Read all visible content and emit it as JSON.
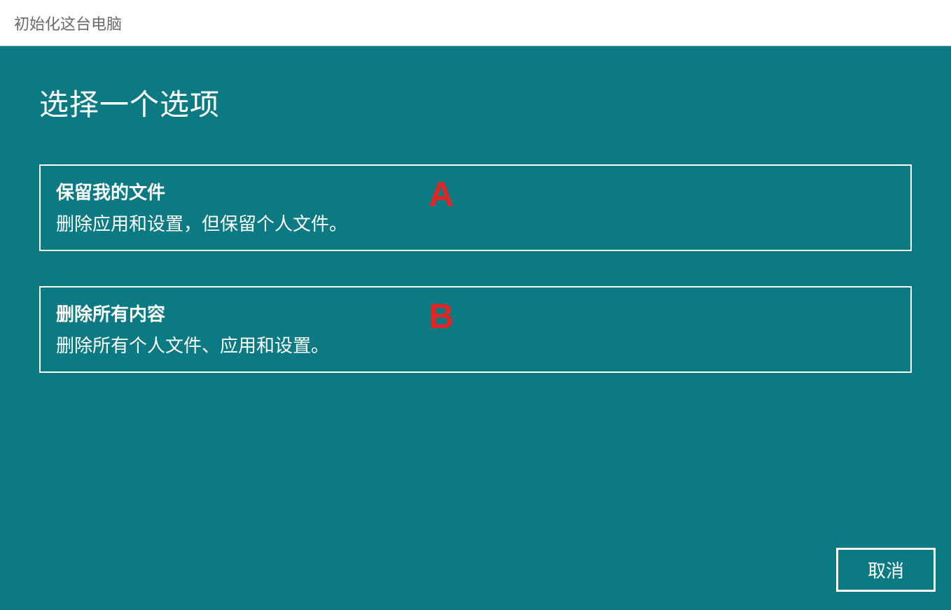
{
  "titlebar": {
    "title": "初始化这台电脑"
  },
  "main": {
    "heading": "选择一个选项",
    "options": [
      {
        "title": "保留我的文件",
        "description": "删除应用和设置，但保留个人文件。",
        "annotation": "A"
      },
      {
        "title": "删除所有内容",
        "description": "删除所有个人文件、应用和设置。",
        "annotation": "B"
      }
    ]
  },
  "footer": {
    "cancel_label": "取消"
  }
}
